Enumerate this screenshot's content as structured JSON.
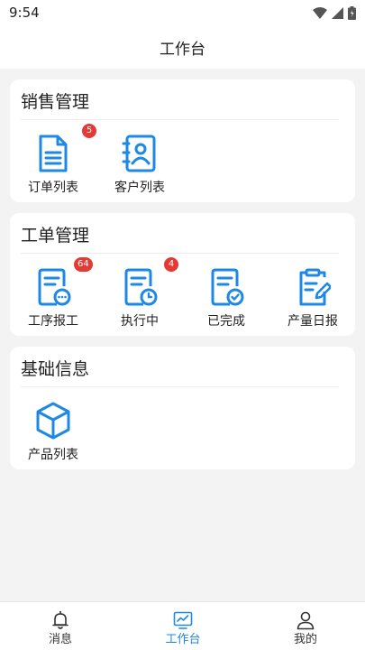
{
  "status_bar": {
    "time": "9:54"
  },
  "header": {
    "title": "工作台"
  },
  "sections": [
    {
      "title": "销售管理",
      "items": [
        {
          "label": "订单列表",
          "icon": "document-list-icon",
          "badge": "5"
        },
        {
          "label": "客户列表",
          "icon": "contact-book-icon",
          "badge": ""
        }
      ]
    },
    {
      "title": "工单管理",
      "items": [
        {
          "label": "工序报工",
          "icon": "document-more-icon",
          "badge": "64"
        },
        {
          "label": "执行中",
          "icon": "document-clock-icon",
          "badge": "4"
        },
        {
          "label": "已完成",
          "icon": "document-check-icon",
          "badge": ""
        },
        {
          "label": "产量日报",
          "icon": "clipboard-edit-icon",
          "badge": ""
        }
      ]
    },
    {
      "title": "基础信息",
      "items": [
        {
          "label": "产品列表",
          "icon": "cube-icon",
          "badge": ""
        }
      ]
    }
  ],
  "tabbar": {
    "tabs": [
      {
        "label": "消息",
        "icon": "bell-icon",
        "active": false
      },
      {
        "label": "工作台",
        "icon": "monitor-chart-icon",
        "active": true
      },
      {
        "label": "我的",
        "icon": "user-icon",
        "active": false
      }
    ]
  },
  "colors": {
    "accent": "#1e88e5",
    "badge": "#e53935",
    "background": "#f3f3f3"
  }
}
